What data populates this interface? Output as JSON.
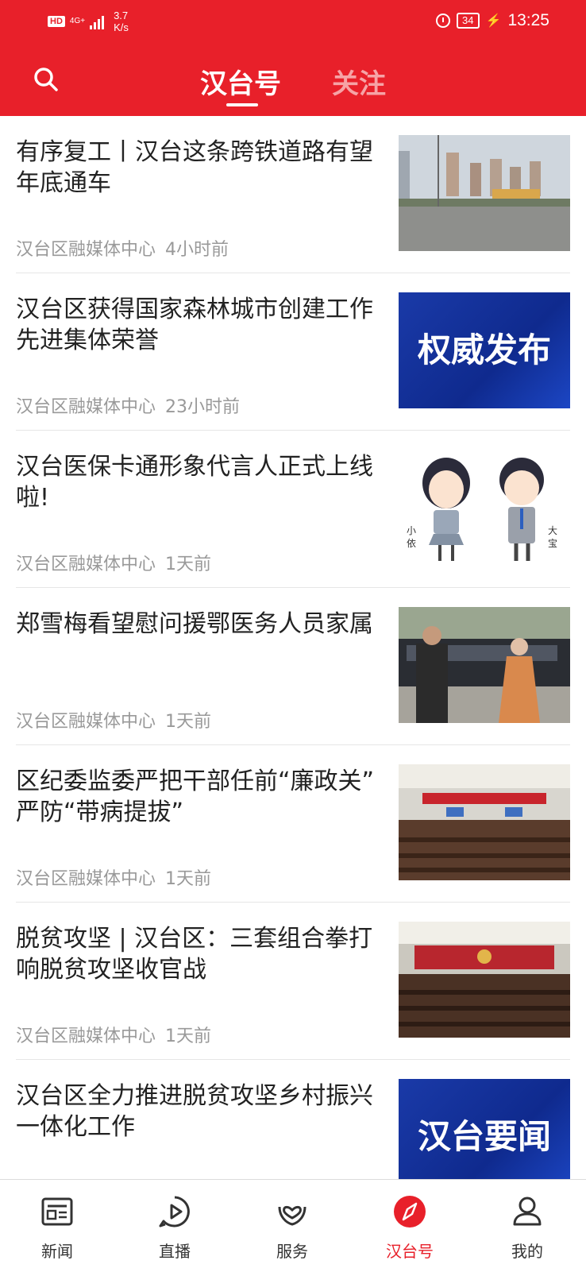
{
  "status_bar": {
    "hd": "HD",
    "network": "4G+",
    "speed_value": "3.7",
    "speed_unit": "K/s",
    "battery": "34",
    "time": "13:25"
  },
  "header": {
    "tabs": [
      {
        "label": "汉台号",
        "active": true
      },
      {
        "label": "关注",
        "active": false
      }
    ]
  },
  "news": [
    {
      "title": "有序复工丨汉台这条跨铁道路有望年底通车",
      "source": "汉台区融媒体中心",
      "time": "4小时前",
      "thumb_text": ""
    },
    {
      "title": "汉台区获得国家森林城市创建工作先进集体荣誉",
      "source": "汉台区融媒体中心",
      "time": "23小时前",
      "thumb_text": "权威发布"
    },
    {
      "title": "汉台医保卡通形象代言人正式上线啦!",
      "source": "汉台区融媒体中心",
      "time": "1天前",
      "thumb_text": "",
      "thumb_labels": [
        "小依",
        "大宝"
      ]
    },
    {
      "title": "郑雪梅看望慰问援鄂医务人员家属",
      "source": "汉台区融媒体中心",
      "time": "1天前",
      "thumb_text": ""
    },
    {
      "title": "区纪委监委严把干部任前“廉政关” 严防“带病提拔”",
      "source": "汉台区融媒体中心",
      "time": "1天前",
      "thumb_text": ""
    },
    {
      "title": "脱贫攻坚 | 汉台区：三套组合拳打响脱贫攻坚收官战",
      "source": "汉台区融媒体中心",
      "time": "1天前",
      "thumb_text": ""
    },
    {
      "title": "汉台区全力推进脱贫攻坚乡村振兴一体化工作",
      "source": "",
      "time": "",
      "thumb_text": "汉台要闻"
    }
  ],
  "bottom_nav": [
    {
      "label": "新闻",
      "icon": "newspaper-icon",
      "active": false
    },
    {
      "label": "直播",
      "icon": "play-icon",
      "active": false
    },
    {
      "label": "服务",
      "icon": "heart-hands-icon",
      "active": false
    },
    {
      "label": "汉台号",
      "icon": "compass-icon",
      "active": true
    },
    {
      "label": "我的",
      "icon": "user-icon",
      "active": false
    }
  ],
  "colors": {
    "brand": "#e8202a",
    "meta": "#999999"
  }
}
